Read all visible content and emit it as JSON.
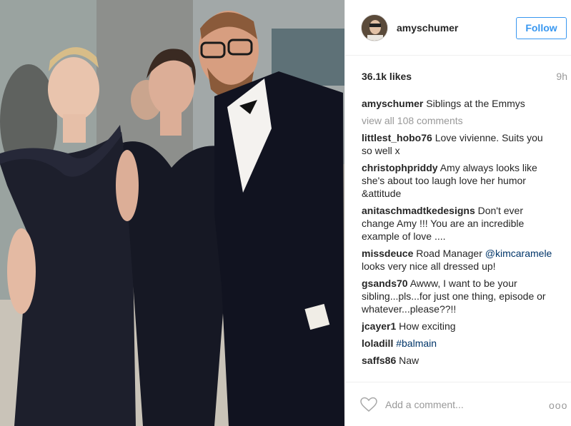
{
  "post": {
    "username": "amyschumer",
    "follow_label": "Follow",
    "likes": "36.1k likes",
    "time": "9h",
    "caption_user": "amyschumer",
    "caption_text": "Siblings at the Emmys",
    "view_all": "view all 108 comments"
  },
  "comments": [
    {
      "user": "littlest_hobo76",
      "text": "Love vivienne. Suits you so well x"
    },
    {
      "user": "christophpriddy",
      "text": "Amy always looks like she's about too laugh love her humor &attitude"
    },
    {
      "user": "anitaschmadtkedesigns",
      "text": "Don't ever change Amy !!! You are an incredible example of love ...."
    },
    {
      "user": "missdeuce",
      "text": "Road Manager",
      "link": "@kimcaramele",
      "text_after": "looks very nice all dressed up!"
    },
    {
      "user": "gsands70",
      "text": "Awww, I want to be your sibling...pls...for just one thing, episode or whatever...please??!!"
    },
    {
      "user": "jcayer1",
      "text": "How exciting"
    },
    {
      "user": "loladill",
      "link": "#balmain"
    },
    {
      "user": "saffs86",
      "text": "Naw"
    }
  ],
  "footer": {
    "comment_placeholder": "Add a comment...",
    "more_label": "ooo"
  },
  "icons": {
    "like": "heart-icon",
    "more": "more-options-icon"
  },
  "colors": {
    "accent": "#3897f0",
    "link": "#003569",
    "muted": "#999999",
    "text": "#262626"
  }
}
